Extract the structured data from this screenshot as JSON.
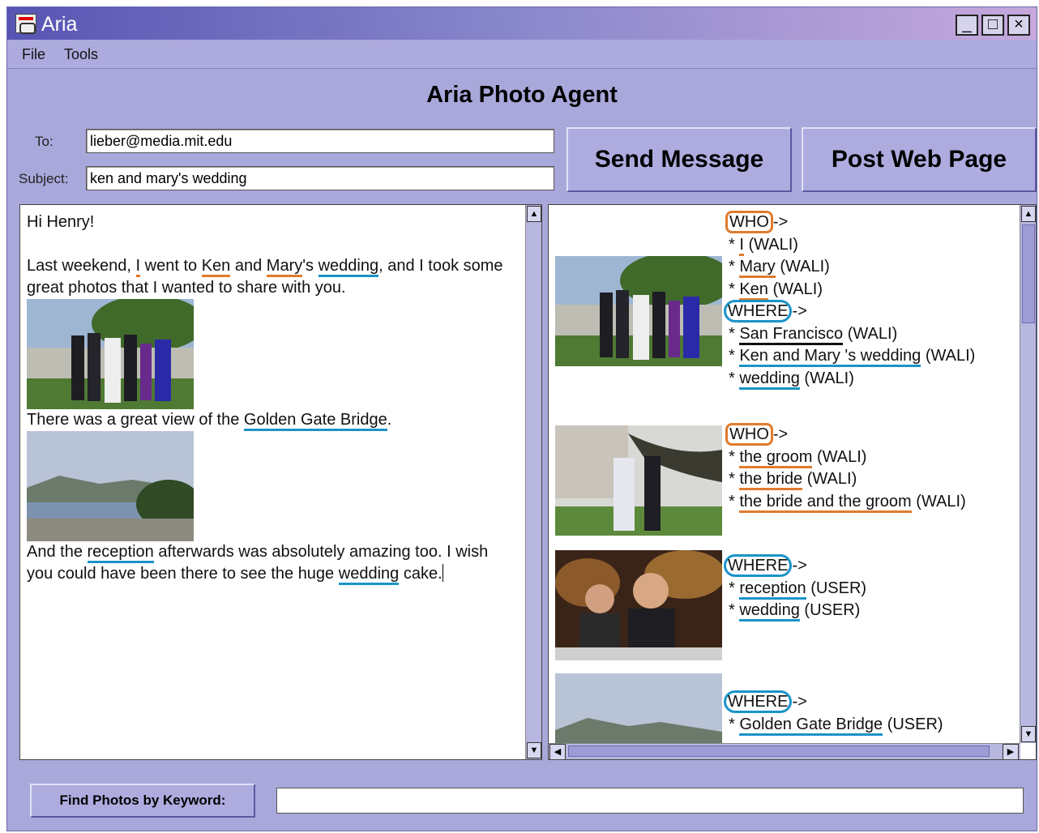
{
  "window": {
    "title": "Aria",
    "controls": [
      "_",
      "□",
      "×"
    ]
  },
  "menubar": {
    "items": [
      "File",
      "Tools"
    ]
  },
  "heading": "Aria Photo Agent",
  "compose": {
    "to_label": "To:",
    "to_value": "lieber@media.mit.edu",
    "subject_label": "Subject:",
    "subject_value": "ken and mary's wedding",
    "send_label": "Send Message",
    "post_label": "Post Web Page"
  },
  "editor": {
    "greeting": "Hi Henry!",
    "p1": {
      "a": "Last weekend, ",
      "i": "I",
      "b": " went to ",
      "ken": "Ken",
      "c": " and ",
      "mary": "Mary",
      "d": "'s ",
      "wedding": "wedding",
      "e": ", and I took some great photos that I wanted to share with you."
    },
    "p2": {
      "a": "There was a great view of the ",
      "ggb": "Golden Gate Bridge",
      "b": "."
    },
    "p3": {
      "a": "And the ",
      "reception": "reception",
      "b": " afterwards was absolutely amazing too. I wish you could have been there to see the huge ",
      "wedding": "wedding",
      "c": " cake."
    }
  },
  "annotations": [
    {
      "who_tag": "WHO",
      "who_arrow": "->",
      "who": [
        {
          "term": "I",
          "src": "(WALI)"
        },
        {
          "term": "Mary",
          "src": "(WALI)"
        },
        {
          "term": "Ken",
          "src": "(WALI)"
        }
      ],
      "where_tag": "WHERE",
      "where_arrow": "->",
      "where": [
        {
          "term": "San Francisco",
          "src": "(WALI)"
        },
        {
          "term": "Ken and Mary 's wedding",
          "src": "(WALI)"
        },
        {
          "term": "wedding",
          "src": "(WALI)"
        }
      ]
    },
    {
      "who_tag": "WHO",
      "who_arrow": "->",
      "who": [
        {
          "term": "the groom",
          "src": "(WALI)"
        },
        {
          "term": "the bride",
          "src": "(WALI)"
        },
        {
          "term": "the bride and the groom",
          "src": "(WALI)"
        }
      ]
    },
    {
      "where_tag": "WHERE",
      "where_arrow": "->",
      "where": [
        {
          "term": "reception",
          "src": "(USER)"
        },
        {
          "term": "wedding",
          "src": "(USER)"
        }
      ]
    },
    {
      "where_tag": "WHERE",
      "where_arrow": "->",
      "where": [
        {
          "term": "Golden Gate Bridge",
          "src": "(USER)"
        }
      ]
    }
  ],
  "find": {
    "button_label": "Find Photos by Keyword:",
    "input_value": ""
  },
  "colors": {
    "who": "#e07b2c",
    "where": "#1a93c8",
    "window_bg": "#a9a8db"
  }
}
